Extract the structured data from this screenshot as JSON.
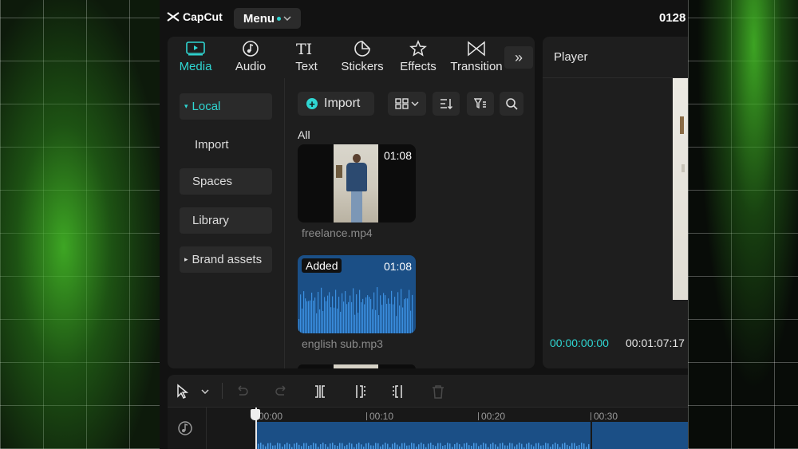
{
  "app": {
    "logo_text": "CapCut",
    "menu_label": "Menu",
    "project_name": "0128"
  },
  "tabs": [
    {
      "label": "Media",
      "icon": "media-icon",
      "active": true
    },
    {
      "label": "Audio",
      "icon": "audio-icon",
      "active": false
    },
    {
      "label": "Text",
      "icon": "text-icon",
      "active": false
    },
    {
      "label": "Stickers",
      "icon": "stickers-icon",
      "active": false
    },
    {
      "label": "Effects",
      "icon": "effects-icon",
      "active": false
    },
    {
      "label": "Transition",
      "icon": "transition-icon",
      "active": false
    }
  ],
  "more_tabs_icon": "chevron-double-right-icon",
  "sidebar": {
    "items": [
      {
        "label": "Local",
        "active": true,
        "expandable": true
      },
      {
        "label": "Import",
        "active": false,
        "expandable": false
      },
      {
        "label": "Spaces",
        "active": false,
        "expandable": false
      },
      {
        "label": "Library",
        "active": false,
        "expandable": false
      },
      {
        "label": "Brand assets",
        "active": false,
        "expandable": true
      }
    ]
  },
  "media_toolbar": {
    "import_label": "Import",
    "icons": [
      "grid-view-icon",
      "sort-icon",
      "filter-icon",
      "search-icon"
    ]
  },
  "media": {
    "section_label": "All",
    "items": [
      {
        "name": "freelance.mp4",
        "duration": "01:08",
        "kind": "video",
        "added": false
      },
      {
        "name": "english sub.mp3",
        "duration": "01:08",
        "kind": "audio",
        "added": true,
        "badge": "Added"
      }
    ]
  },
  "player": {
    "title": "Player",
    "current_time": "00:00:00:00",
    "total_time": "00:01:07:17"
  },
  "timeline": {
    "ticks": [
      "00:00",
      "00:10",
      "00:20",
      "00:30"
    ],
    "tools": [
      "select-icon",
      "undo-icon",
      "redo-icon",
      "split-icon",
      "split-left-icon",
      "split-right-icon",
      "delete-icon"
    ]
  },
  "colors": {
    "accent": "#2fd6d2",
    "panel": "#1e1e1e",
    "audio_clip": "#1b4f86"
  }
}
